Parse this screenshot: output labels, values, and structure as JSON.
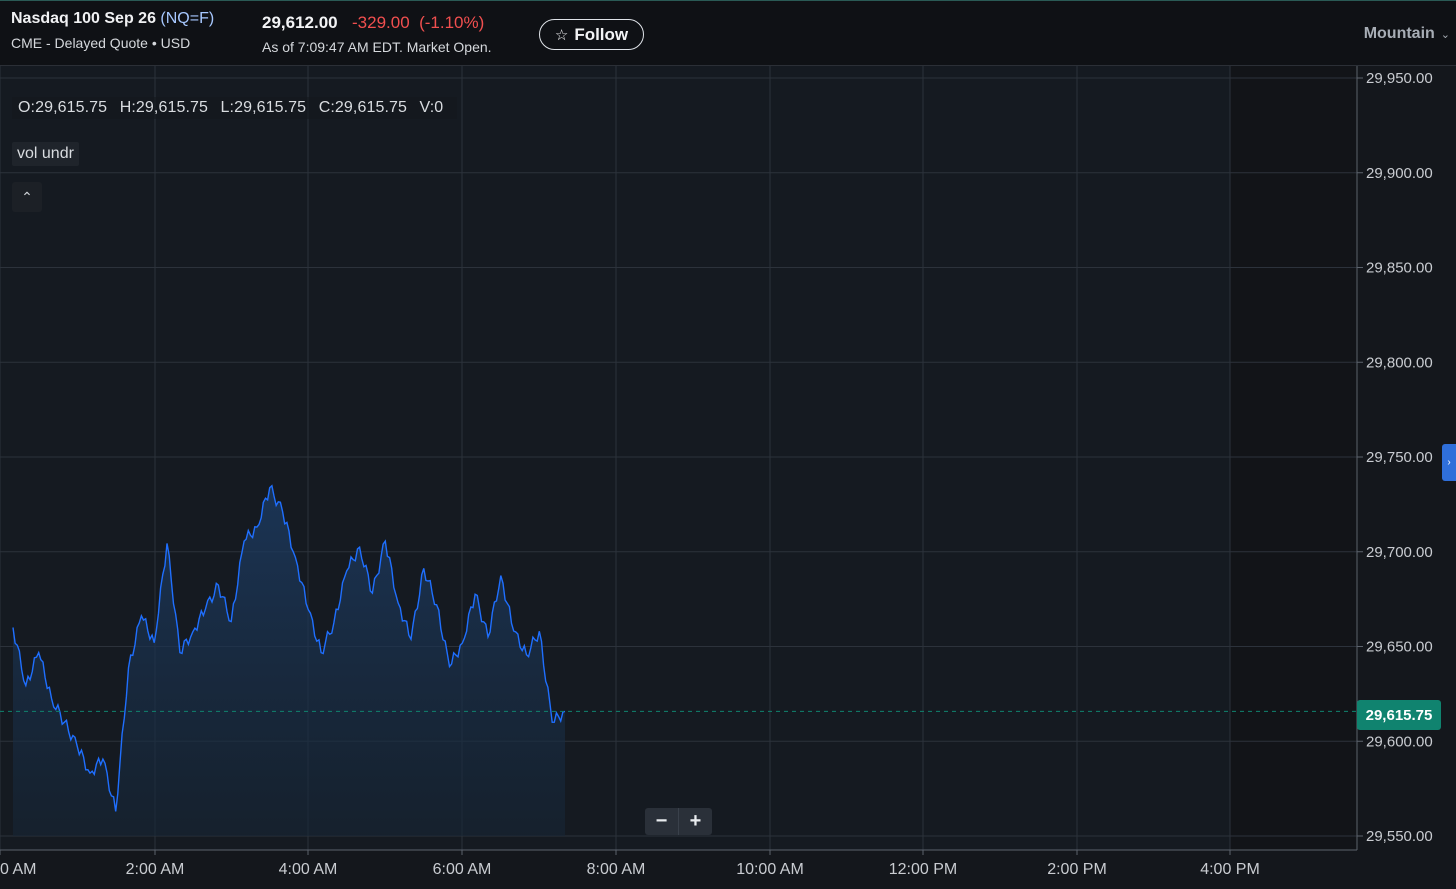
{
  "header": {
    "name": "Nasdaq 100 Sep 26",
    "symbol_open": "(",
    "symbol": "NQ=F",
    "symbol_close": ")",
    "exchange_line": "CME - Delayed Quote • USD",
    "price": "29,612.00",
    "change": "-329.00  (-1.10%)",
    "as_of": "As of 7:09:47 AM EDT. Market Open.",
    "follow_label": "Follow",
    "timezone": "Mountain"
  },
  "ohlc": {
    "open": "O:29,615.75",
    "high": "H:29,615.75",
    "low": "L:29,615.75",
    "close": "C:29,615.75",
    "volume": "V:0"
  },
  "study_label": "vol undr",
  "last_price_tag": "29,615.75",
  "zoom": {
    "minus": "−",
    "plus": "+"
  },
  "colors": {
    "line": "#1f6fff",
    "last_price": "#10836f",
    "change_negative": "#f04f4f"
  },
  "chart_data": {
    "type": "area",
    "y_ticks": [
      "29,950.00",
      "29,900.00",
      "29,850.00",
      "29,800.00",
      "29,750.00",
      "29,700.00",
      "29,650.00",
      "29,600.00",
      "29,550.00"
    ],
    "x_ticks": [
      "0 AM",
      "2:00 AM",
      "4:00 AM",
      "6:00 AM",
      "8:00 AM",
      "10:00 AM",
      "12:00 PM",
      "2:00 PM",
      "4:00 PM"
    ],
    "ylim": [
      29550,
      29950
    ],
    "grid": true,
    "last_value": 29615.75,
    "series": [
      {
        "x": [
          "12:00 AM",
          "12:10 AM",
          "12:20 AM",
          "12:30 AM",
          "12:40 AM",
          "12:50 AM",
          "1:00 AM",
          "1:10 AM",
          "1:20 AM",
          "1:30 AM",
          "1:40 AM",
          "1:50 AM",
          "2:00 AM",
          "2:10 AM",
          "2:20 AM",
          "2:30 AM",
          "2:40 AM",
          "2:50 AM",
          "3:00 AM",
          "3:10 AM",
          "3:20 AM",
          "3:30 AM",
          "3:40 AM",
          "3:50 AM",
          "4:00 AM",
          "4:10 AM",
          "4:20 AM",
          "4:30 AM",
          "4:40 AM",
          "4:50 AM",
          "5:00 AM",
          "5:10 AM",
          "5:20 AM",
          "5:30 AM",
          "5:40 AM",
          "5:50 AM",
          "6:00 AM",
          "6:10 AM",
          "6:20 AM",
          "6:30 AM",
          "6:40 AM",
          "6:50 AM",
          "7:00 AM",
          "7:09 AM"
        ],
        "values": [
          29660,
          29630,
          29645,
          29625,
          29610,
          29595,
          29585,
          29590,
          29560,
          29640,
          29665,
          29655,
          29705,
          29645,
          29660,
          29670,
          29680,
          29665,
          29705,
          29710,
          29735,
          29720,
          29700,
          29670,
          29645,
          29665,
          29690,
          29700,
          29680,
          29705,
          29670,
          29655,
          29690,
          29675,
          29640,
          29650,
          29680,
          29655,
          29685,
          29660,
          29645,
          29655,
          29610,
          29615.75
        ]
      }
    ]
  }
}
